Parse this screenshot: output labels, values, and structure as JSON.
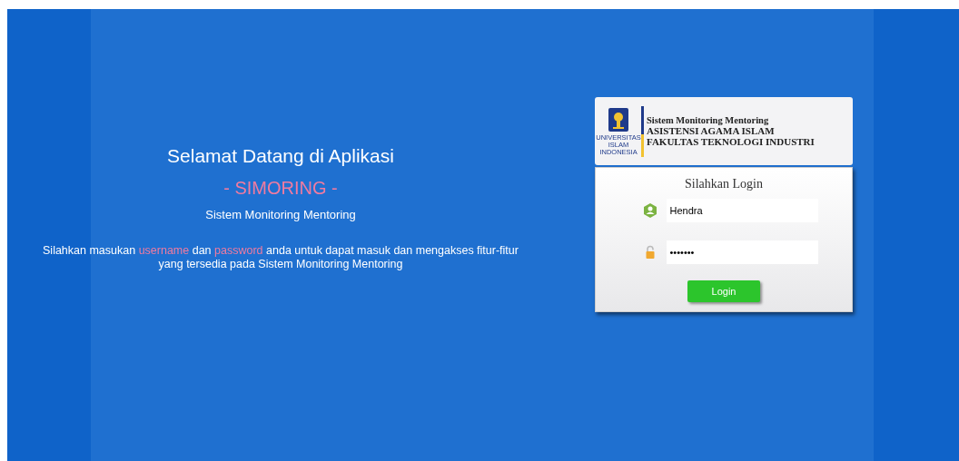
{
  "welcome": {
    "title": "Selamat Datang di Aplikasi",
    "app_name": "- SIMORING -",
    "subtitle": "Sistem Monitoring Mentoring",
    "intro": [
      {
        "text": "Silahkan masukan ",
        "highlight": false
      },
      {
        "text": "username",
        "highlight": true
      },
      {
        "text": " dan ",
        "highlight": false
      },
      {
        "text": "password",
        "highlight": true
      },
      {
        "text": " anda untuk dapat masuk dan mengakses fitur-fitur yang tersedia pada Sistem Monitoring Mentoring",
        "highlight": false
      }
    ]
  },
  "login_card": {
    "logo_text": [
      "UNIVERSITAS",
      "ISLAM",
      "INDONESIA"
    ],
    "header_lines": [
      "Sistem Monitoring Mentoring",
      "ASISTENSI AGAMA ISLAM",
      "FAKULTAS TEKNOLOGI INDUSTRI"
    ],
    "heading": "Silahkan Login",
    "fields": [
      {
        "kind": "username",
        "value": "Hendra"
      },
      {
        "kind": "password",
        "value": "•••••••"
      }
    ],
    "button": "Login"
  }
}
